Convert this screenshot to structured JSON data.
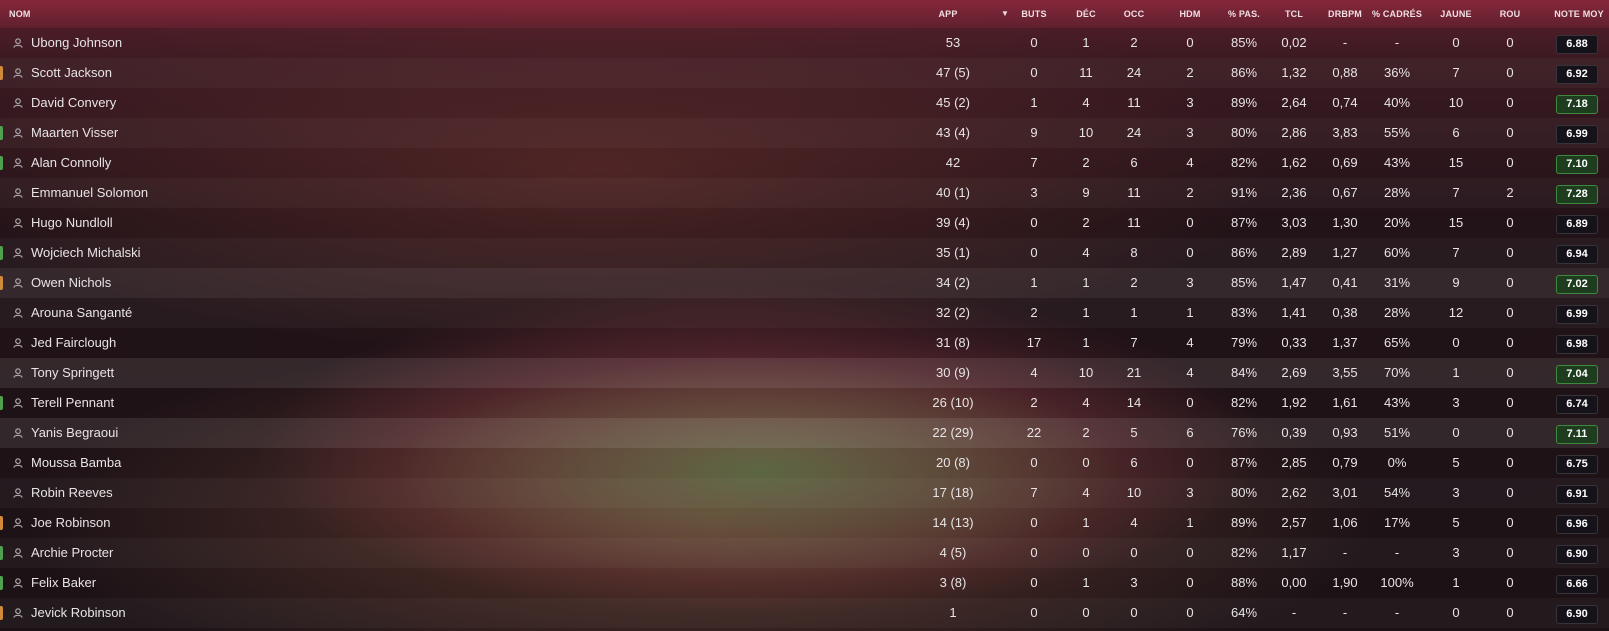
{
  "columns": {
    "name": "NOM",
    "app": "APP",
    "buts": "BUTS",
    "dec": "DÉC",
    "occ": "OCC",
    "hdm": "HDM",
    "pas": "% PAS.",
    "tcl": "TCL",
    "drb": "DRBPM",
    "cad": "% CADRÉS",
    "jaune": "JAUNE",
    "rou": "ROU",
    "note": "NOTE MOY"
  },
  "sort": {
    "column": "APP",
    "direction": "descending",
    "icon": "sort-down-arrow-icon"
  },
  "colors": {
    "header": "#8c2a3c",
    "rating_good": "#1e3d1f",
    "rating_default": "#15121a"
  },
  "players": [
    {
      "name": "Ubong Johnson",
      "app": "53",
      "buts": "0",
      "dec": "1",
      "occ": "2",
      "hdm": "0",
      "pas": "85%",
      "tcl": "0,02",
      "drb": "-",
      "cad": "-",
      "jaune": "0",
      "rou": "0",
      "note": "6.88",
      "good": false,
      "edge": ""
    },
    {
      "name": "Scott Jackson",
      "app": "47 (5)",
      "buts": "0",
      "dec": "11",
      "occ": "24",
      "hdm": "2",
      "pas": "86%",
      "tcl": "1,32",
      "drb": "0,88",
      "cad": "36%",
      "jaune": "7",
      "rou": "0",
      "note": "6.92",
      "good": false,
      "edge": "#d08a3a"
    },
    {
      "name": "David Convery",
      "app": "45 (2)",
      "buts": "1",
      "dec": "4",
      "occ": "11",
      "hdm": "3",
      "pas": "89%",
      "tcl": "2,64",
      "drb": "0,74",
      "cad": "40%",
      "jaune": "10",
      "rou": "0",
      "note": "7.18",
      "good": true,
      "edge": ""
    },
    {
      "name": "Maarten Visser",
      "app": "43 (4)",
      "buts": "9",
      "dec": "10",
      "occ": "24",
      "hdm": "3",
      "pas": "80%",
      "tcl": "2,86",
      "drb": "3,83",
      "cad": "55%",
      "jaune": "6",
      "rou": "0",
      "note": "6.99",
      "good": false,
      "edge": "#4fa04f"
    },
    {
      "name": "Alan Connolly",
      "app": "42",
      "buts": "7",
      "dec": "2",
      "occ": "6",
      "hdm": "4",
      "pas": "82%",
      "tcl": "1,62",
      "drb": "0,69",
      "cad": "43%",
      "jaune": "15",
      "rou": "0",
      "note": "7.10",
      "good": true,
      "edge": "#4fa04f"
    },
    {
      "name": "Emmanuel Solomon",
      "app": "40 (1)",
      "buts": "3",
      "dec": "9",
      "occ": "11",
      "hdm": "2",
      "pas": "91%",
      "tcl": "2,36",
      "drb": "0,67",
      "cad": "28%",
      "jaune": "7",
      "rou": "2",
      "note": "7.28",
      "good": true,
      "edge": ""
    },
    {
      "name": "Hugo Nundloll",
      "app": "39 (4)",
      "buts": "0",
      "dec": "2",
      "occ": "11",
      "hdm": "0",
      "pas": "87%",
      "tcl": "3,03",
      "drb": "1,30",
      "cad": "20%",
      "jaune": "15",
      "rou": "0",
      "note": "6.89",
      "good": false,
      "edge": ""
    },
    {
      "name": "Wojciech Michalski",
      "app": "35 (1)",
      "buts": "0",
      "dec": "4",
      "occ": "8",
      "hdm": "0",
      "pas": "86%",
      "tcl": "2,89",
      "drb": "1,27",
      "cad": "60%",
      "jaune": "7",
      "rou": "0",
      "note": "6.94",
      "good": false,
      "edge": "#4fa04f"
    },
    {
      "name": "Owen Nichols",
      "app": "34 (2)",
      "buts": "1",
      "dec": "1",
      "occ": "2",
      "hdm": "3",
      "pas": "85%",
      "tcl": "1,47",
      "drb": "0,41",
      "cad": "31%",
      "jaune": "9",
      "rou": "0",
      "note": "7.02",
      "good": true,
      "edge": "#d08a3a"
    },
    {
      "name": "Arouna Sanganté",
      "app": "32 (2)",
      "buts": "2",
      "dec": "1",
      "occ": "1",
      "hdm": "1",
      "pas": "83%",
      "tcl": "1,41",
      "drb": "0,38",
      "cad": "28%",
      "jaune": "12",
      "rou": "0",
      "note": "6.99",
      "good": false,
      "edge": ""
    },
    {
      "name": "Jed Fairclough",
      "app": "31 (8)",
      "buts": "17",
      "dec": "1",
      "occ": "7",
      "hdm": "4",
      "pas": "79%",
      "tcl": "0,33",
      "drb": "1,37",
      "cad": "65%",
      "jaune": "0",
      "rou": "0",
      "note": "6.98",
      "good": false,
      "edge": ""
    },
    {
      "name": "Tony Springett",
      "app": "30 (9)",
      "buts": "4",
      "dec": "10",
      "occ": "21",
      "hdm": "4",
      "pas": "84%",
      "tcl": "2,69",
      "drb": "3,55",
      "cad": "70%",
      "jaune": "1",
      "rou": "0",
      "note": "7.04",
      "good": true,
      "edge": ""
    },
    {
      "name": "Terell Pennant",
      "app": "26 (10)",
      "buts": "2",
      "dec": "4",
      "occ": "14",
      "hdm": "0",
      "pas": "82%",
      "tcl": "1,92",
      "drb": "1,61",
      "cad": "43%",
      "jaune": "3",
      "rou": "0",
      "note": "6.74",
      "good": false,
      "edge": "#4fa04f"
    },
    {
      "name": "Yanis Begraoui",
      "app": "22 (29)",
      "buts": "22",
      "dec": "2",
      "occ": "5",
      "hdm": "6",
      "pas": "76%",
      "tcl": "0,39",
      "drb": "0,93",
      "cad": "51%",
      "jaune": "0",
      "rou": "0",
      "note": "7.11",
      "good": true,
      "edge": ""
    },
    {
      "name": "Moussa Bamba",
      "app": "20 (8)",
      "buts": "0",
      "dec": "0",
      "occ": "6",
      "hdm": "0",
      "pas": "87%",
      "tcl": "2,85",
      "drb": "0,79",
      "cad": "0%",
      "jaune": "5",
      "rou": "0",
      "note": "6.75",
      "good": false,
      "edge": ""
    },
    {
      "name": "Robin Reeves",
      "app": "17 (18)",
      "buts": "7",
      "dec": "4",
      "occ": "10",
      "hdm": "3",
      "pas": "80%",
      "tcl": "2,62",
      "drb": "3,01",
      "cad": "54%",
      "jaune": "3",
      "rou": "0",
      "note": "6.91",
      "good": false,
      "edge": ""
    },
    {
      "name": "Joe Robinson",
      "app": "14 (13)",
      "buts": "0",
      "dec": "1",
      "occ": "4",
      "hdm": "1",
      "pas": "89%",
      "tcl": "2,57",
      "drb": "1,06",
      "cad": "17%",
      "jaune": "5",
      "rou": "0",
      "note": "6.96",
      "good": false,
      "edge": "#d08a3a"
    },
    {
      "name": "Archie Procter",
      "app": "4 (5)",
      "buts": "0",
      "dec": "0",
      "occ": "0",
      "hdm": "0",
      "pas": "82%",
      "tcl": "1,17",
      "drb": "-",
      "cad": "-",
      "jaune": "3",
      "rou": "0",
      "note": "6.90",
      "good": false,
      "edge": "#4fa04f"
    },
    {
      "name": "Felix Baker",
      "app": "3 (8)",
      "buts": "0",
      "dec": "1",
      "occ": "3",
      "hdm": "0",
      "pas": "88%",
      "tcl": "0,00",
      "drb": "1,90",
      "cad": "100%",
      "jaune": "1",
      "rou": "0",
      "note": "6.66",
      "good": false,
      "edge": "#4fa04f"
    },
    {
      "name": "Jevick Robinson",
      "app": "1",
      "buts": "0",
      "dec": "0",
      "occ": "0",
      "hdm": "0",
      "pas": "64%",
      "tcl": "-",
      "drb": "-",
      "cad": "-",
      "jaune": "0",
      "rou": "0",
      "note": "6.90",
      "good": false,
      "edge": "#d08a3a"
    }
  ]
}
